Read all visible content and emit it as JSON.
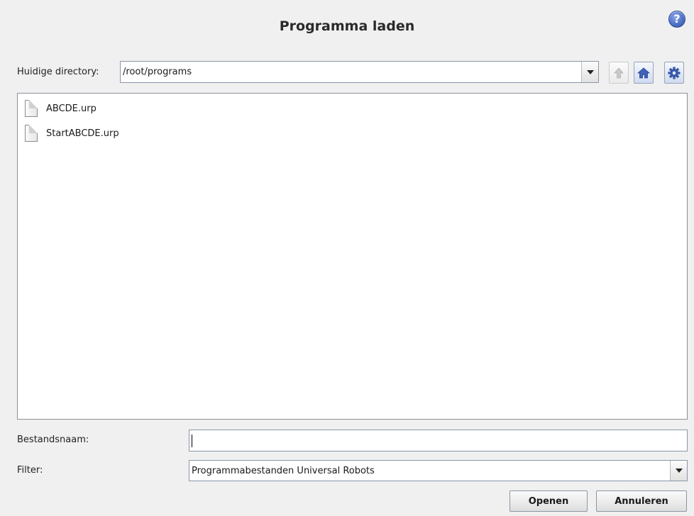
{
  "dialog": {
    "title": "Programma laden",
    "help_icon": "question-circle-icon",
    "help_glyph": "?"
  },
  "directory": {
    "label": "Huidige directory:",
    "value": "/root/programs",
    "buttons": [
      {
        "name": "up-button",
        "icon": "arrow-up-icon",
        "enabled": false
      },
      {
        "name": "home-button",
        "icon": "home-icon",
        "enabled": true
      },
      {
        "name": "settings-button",
        "icon": "gear-icon",
        "enabled": true
      }
    ]
  },
  "files": [
    {
      "name": "ABCDE.urp",
      "icon": "document-icon"
    },
    {
      "name": "StartABCDE.urp",
      "icon": "document-icon"
    }
  ],
  "filename": {
    "label": "Bestandsnaam:",
    "value": ""
  },
  "filter": {
    "label": "Filter:",
    "value": "Programmabestanden Universal Robots"
  },
  "actions": {
    "open_label": "Openen",
    "cancel_label": "Annuleren"
  },
  "colors": {
    "accent_blue": "#4f72c8",
    "background": "#f0f0f0"
  }
}
